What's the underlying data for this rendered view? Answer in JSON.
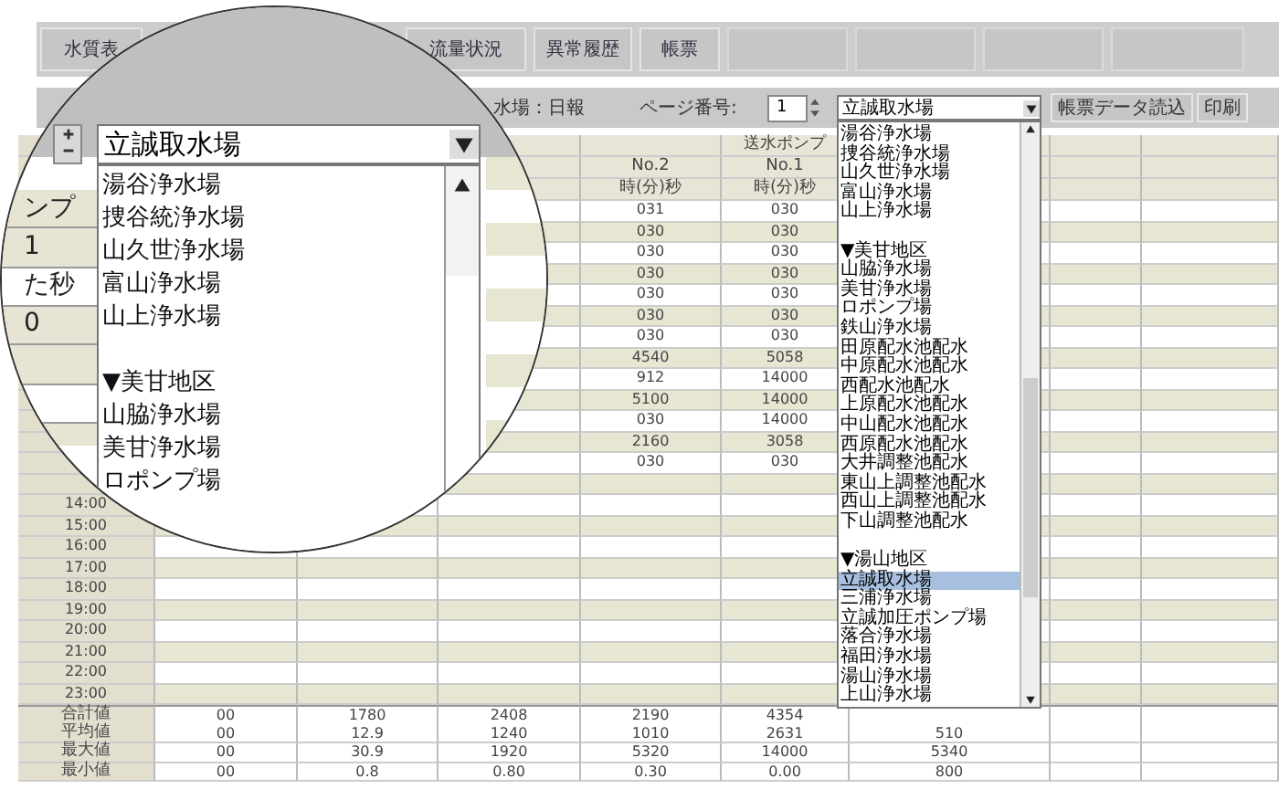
{
  "tabs": [
    {
      "label": "水質表"
    },
    {
      "label": "流量状況"
    },
    {
      "label": "異常履歴"
    },
    {
      "label": "帳票"
    }
  ],
  "toolbar": {
    "report_title": "水場：日報",
    "page_label": "ページ番号:",
    "page_number": "1",
    "station_select": {
      "value": "立誠取水場",
      "expanded": true
    },
    "buttons": [
      "帳票データ読込",
      "印刷"
    ]
  },
  "station_list": {
    "items": [
      {
        "label": "湯谷浄水場",
        "selected": false
      },
      {
        "label": "捜谷統浄水場",
        "selected": false
      },
      {
        "label": "山久世浄水場",
        "selected": false
      },
      {
        "label": "富山浄水場",
        "selected": false
      },
      {
        "label": "山上浄水場",
        "selected": false
      },
      {
        "kind": "blank"
      },
      {
        "label": "▼美甘地区",
        "selected": false
      },
      {
        "label": "山脇浄水場",
        "selected": false
      },
      {
        "label": "美甘浄水場",
        "selected": false
      },
      {
        "label": "ロポンプ場",
        "selected": false
      },
      {
        "label": "鉄山浄水場",
        "selected": false
      },
      {
        "label": "田原配水池配水",
        "selected": false
      },
      {
        "label": "中原配水池配水",
        "selected": false
      },
      {
        "label": "西配水池配水",
        "selected": false
      },
      {
        "label": "上原配水池配水",
        "selected": false
      },
      {
        "label": "中山配水池配水",
        "selected": false
      },
      {
        "label": "西原配水池配水",
        "selected": false
      },
      {
        "label": "大井調整池配水",
        "selected": false
      },
      {
        "label": "東山上調整池配水",
        "selected": false
      },
      {
        "label": "西山上調整池配水",
        "selected": false
      },
      {
        "label": "下山調整池配水",
        "selected": false
      },
      {
        "kind": "blank"
      },
      {
        "label": "▼湯山地区",
        "selected": false
      },
      {
        "label": "立誠取水場",
        "selected": true
      },
      {
        "label": "三浦浄水場",
        "selected": false
      },
      {
        "label": "立誠加圧ポンプ場",
        "selected": false
      },
      {
        "label": "落合浄水場",
        "selected": false
      },
      {
        "label": "福田浄水場",
        "selected": false
      },
      {
        "label": "湯山浄水場",
        "selected": false
      },
      {
        "label": "上山浄水場",
        "selected": false
      }
    ]
  },
  "table": {
    "header_rows": [
      {
        "column_5": "送水ポンプ"
      },
      {
        "column_4": "No.2",
        "column_5": "No.1"
      },
      {
        "column_4": "時(分)秒",
        "column_5": "時(分)秒"
      }
    ],
    "rows": [
      {
        "column_4": "031",
        "column_5": "030"
      },
      {
        "column_4": "030",
        "column_5": "030"
      },
      {
        "column_4": "030",
        "column_5": "030"
      },
      {
        "column_4": "030",
        "column_5": "030"
      },
      {
        "column_4": "030",
        "column_5": "030"
      },
      {
        "column_4": "030",
        "column_5": "030"
      },
      {
        "column_4": "030",
        "column_5": "030"
      },
      {
        "column_4": "4540",
        "column_5": "5058"
      },
      {
        "column_4": "912",
        "column_5": "14000"
      },
      {
        "column_4": "5100",
        "column_5": "14000"
      },
      {
        "column_4": "030",
        "column_5": "14000"
      },
      {
        "column_4": "2160",
        "column_5": "3058"
      },
      {
        "column_4": "030",
        "column_5": "030"
      },
      {},
      {
        "time": "14:00"
      },
      {
        "time": "15:00"
      },
      {
        "time": "16:00"
      },
      {
        "time": "17:00"
      },
      {
        "time": "18:00"
      },
      {
        "time": "19:00"
      },
      {
        "time": "20:00"
      },
      {
        "time": "21:00"
      },
      {
        "time": "22:00"
      },
      {
        "time": "23:00"
      }
    ],
    "summary_rows": [
      {
        "label": "合計値",
        "column_1": "00",
        "column_2": "1780",
        "column_3": "2408",
        "column_4": "2190",
        "column_5": "4354"
      },
      {
        "label": "平均値",
        "column_1": "00",
        "column_2": "12.9",
        "column_3": "1240",
        "column_4": "1010",
        "column_5": "2631",
        "column_6": "510"
      },
      {
        "label": "最大値",
        "column_1": "00",
        "column_2": "30.9",
        "column_3": "1920",
        "column_4": "5320",
        "column_5": "14000",
        "column_6": "5340"
      },
      {
        "label": "最小値",
        "column_1": "00",
        "column_2": "0.8",
        "column_3": "0.80",
        "column_4": "0.30",
        "column_5": "0.00",
        "column_6": "800"
      }
    ]
  },
  "magnifier": {
    "combo_value": "立誠取水場",
    "items": [
      {
        "label": "湯谷浄水場"
      },
      {
        "label": "捜谷統浄水場"
      },
      {
        "label": "山久世浄水場"
      },
      {
        "label": "富山浄水場"
      },
      {
        "label": "山上浄水場"
      },
      {
        "kind": "blank"
      },
      {
        "label": "▼美甘地区"
      },
      {
        "label": "山脇浄水場"
      },
      {
        "label": "美甘浄水場"
      },
      {
        "label": "ロポンプ場"
      }
    ],
    "left_cells": [
      "ンプ",
      "1",
      "た秒",
      "0"
    ]
  }
}
